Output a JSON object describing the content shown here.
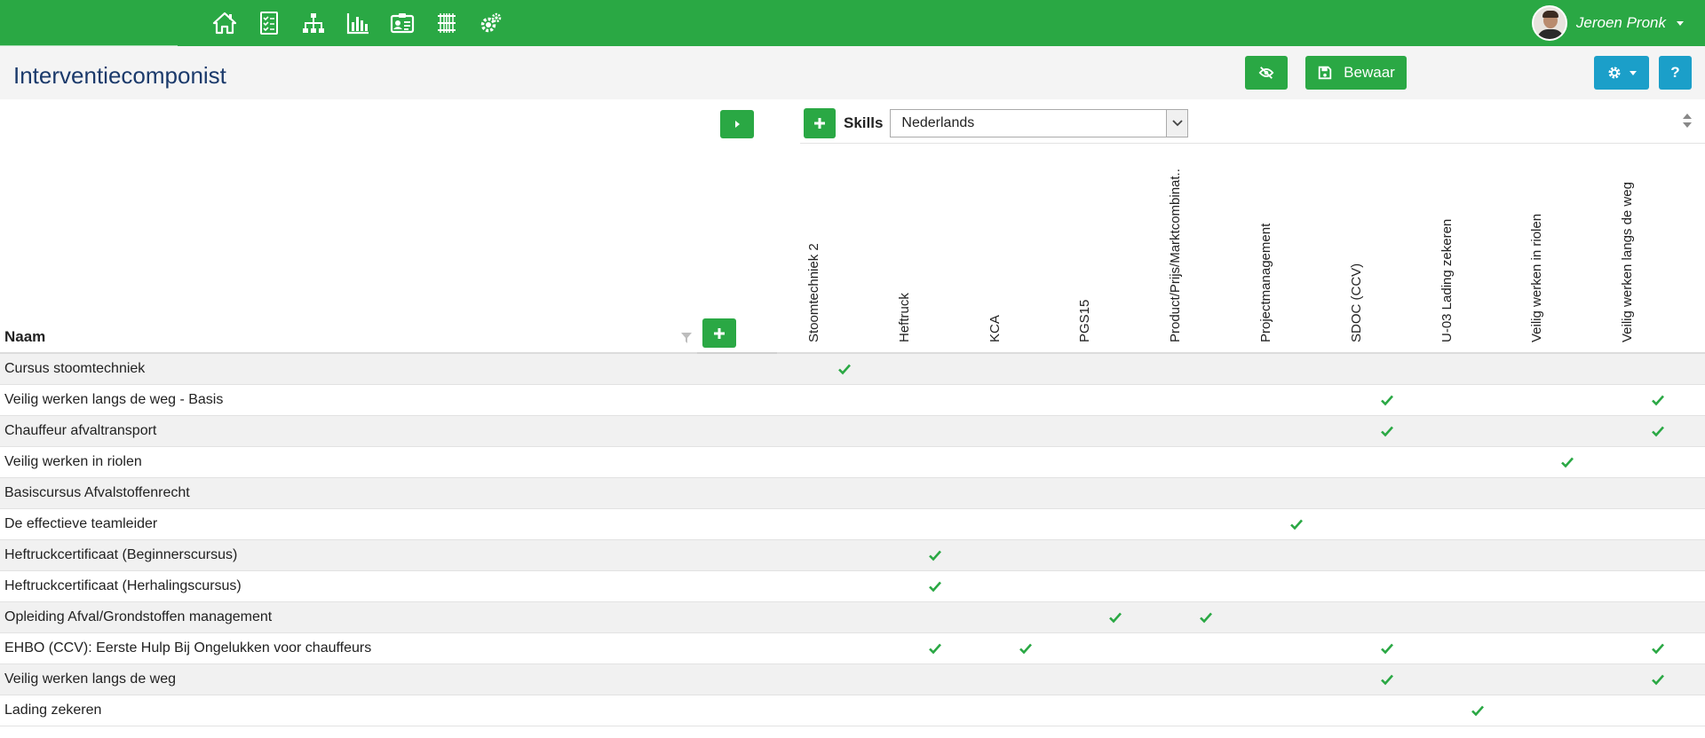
{
  "topbar": {
    "icons": [
      "home-icon",
      "checklist-icon",
      "org-chart-icon",
      "bar-chart-icon",
      "id-card-icon",
      "skills-tree-icon",
      "cogs-icon"
    ],
    "user_name": "Jeroen Pronk"
  },
  "header": {
    "title": "Interventiecomponist",
    "save_label": "Bewaar",
    "help_label": "?"
  },
  "colors": {
    "brand_green": "#2aa844",
    "info_blue": "#1b9fc9",
    "title_blue": "#1b3a6b"
  },
  "toolbar": {
    "skills_label": "Skills",
    "language_selected": "Nederlands"
  },
  "table": {
    "name_header": "Naam",
    "columns": [
      "Stoomtechniek 2",
      "Heftruck",
      "KCA",
      "PGS15",
      "Product/Prijs/Marktcombinat..",
      "Projectmanagement",
      "SDOC (CCV)",
      "U-03 Lading zekeren",
      "Veilig werken in riolen",
      "Veilig werken langs de weg"
    ],
    "rows": [
      {
        "name": "Cursus stoomtechniek",
        "checks": [
          0
        ]
      },
      {
        "name": "Veilig werken langs de weg - Basis",
        "checks": [
          6,
          9
        ]
      },
      {
        "name": "Chauffeur afvaltransport",
        "checks": [
          6,
          9
        ]
      },
      {
        "name": "Veilig werken in riolen",
        "checks": [
          8
        ]
      },
      {
        "name": "Basiscursus Afvalstoffenrecht",
        "checks": []
      },
      {
        "name": "De effectieve teamleider",
        "checks": [
          5
        ]
      },
      {
        "name": "Heftruckcertificaat (Beginnerscursus)",
        "checks": [
          1
        ]
      },
      {
        "name": "Heftruckcertificaat (Herhalingscursus)",
        "checks": [
          1
        ]
      },
      {
        "name": "Opleiding Afval/Grondstoffen management",
        "checks": [
          3,
          4
        ]
      },
      {
        "name": "EHBO (CCV): Eerste Hulp Bij Ongelukken voor chauffeurs",
        "checks": [
          1,
          2,
          6,
          9
        ]
      },
      {
        "name": "Veilig werken langs de weg",
        "checks": [
          6,
          9
        ]
      },
      {
        "name": "Lading zekeren",
        "checks": [
          7
        ]
      }
    ]
  }
}
